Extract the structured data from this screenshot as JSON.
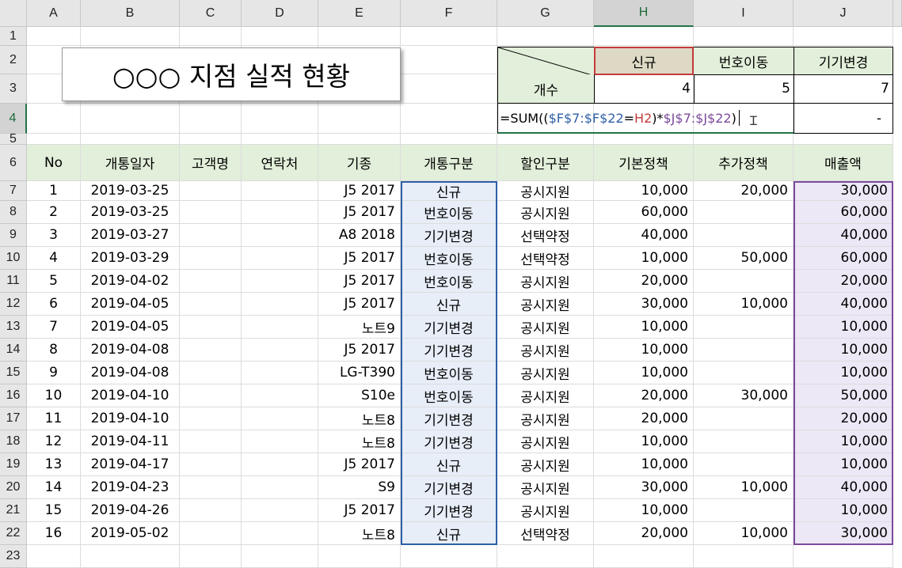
{
  "columns": [
    "A",
    "B",
    "C",
    "D",
    "E",
    "F",
    "G",
    "H",
    "I",
    "J"
  ],
  "rows": [
    "1",
    "2",
    "3",
    "4",
    "5",
    "6",
    "7",
    "8",
    "9",
    "10",
    "11",
    "12",
    "13",
    "14",
    "15",
    "16",
    "17",
    "18",
    "19",
    "20",
    "21",
    "22",
    "23"
  ],
  "selected_column": "H",
  "selected_row": "4",
  "title": "○○○ 지점  실적 현황",
  "summary": {
    "headers": [
      "신규",
      "번호이동",
      "기기변경"
    ],
    "row_label": "개수",
    "counts": [
      "4",
      "5",
      "7"
    ],
    "formula": {
      "p1": "=SUM((",
      "p2": "$F$7:$F$22",
      "p3": "=",
      "p4": "H2",
      "p5": ")*",
      "p6": "$J$7:$J$22",
      "p7": ")"
    },
    "dash": "-"
  },
  "table": {
    "headers": [
      "No",
      "개통일자",
      "고객명",
      "연락처",
      "기종",
      "개통구분",
      "할인구분",
      "기본정책",
      "추가정책",
      "매출액"
    ],
    "rows": [
      [
        "1",
        "2019-03-25",
        "",
        "",
        "J5 2017",
        "신규",
        "공시지원",
        "10,000",
        "20,000",
        "30,000"
      ],
      [
        "2",
        "2019-03-25",
        "",
        "",
        "J5 2017",
        "번호이동",
        "공시지원",
        "60,000",
        "",
        "60,000"
      ],
      [
        "3",
        "2019-03-27",
        "",
        "",
        "A8 2018",
        "기기변경",
        "선택약정",
        "40,000",
        "",
        "40,000"
      ],
      [
        "4",
        "2019-03-29",
        "",
        "",
        "J5 2017",
        "번호이동",
        "선택약정",
        "10,000",
        "50,000",
        "60,000"
      ],
      [
        "5",
        "2019-04-02",
        "",
        "",
        "J5 2017",
        "번호이동",
        "공시지원",
        "20,000",
        "",
        "20,000"
      ],
      [
        "6",
        "2019-04-05",
        "",
        "",
        "J5 2017",
        "신규",
        "공시지원",
        "30,000",
        "10,000",
        "40,000"
      ],
      [
        "7",
        "2019-04-05",
        "",
        "",
        "노트9",
        "기기변경",
        "공시지원",
        "10,000",
        "",
        "10,000"
      ],
      [
        "8",
        "2019-04-08",
        "",
        "",
        "J5 2017",
        "기기변경",
        "공시지원",
        "10,000",
        "",
        "10,000"
      ],
      [
        "9",
        "2019-04-08",
        "",
        "",
        "LG-T390",
        "번호이동",
        "공시지원",
        "10,000",
        "",
        "10,000"
      ],
      [
        "10",
        "2019-04-10",
        "",
        "",
        "S10e",
        "번호이동",
        "공시지원",
        "20,000",
        "30,000",
        "50,000"
      ],
      [
        "11",
        "2019-04-10",
        "",
        "",
        "노트8",
        "기기변경",
        "공시지원",
        "20,000",
        "",
        "20,000"
      ],
      [
        "12",
        "2019-04-11",
        "",
        "",
        "노트8",
        "기기변경",
        "공시지원",
        "10,000",
        "",
        "10,000"
      ],
      [
        "13",
        "2019-04-17",
        "",
        "",
        "J5 2017",
        "신규",
        "공시지원",
        "10,000",
        "",
        "10,000"
      ],
      [
        "14",
        "2019-04-23",
        "",
        "",
        "S9",
        "기기변경",
        "공시지원",
        "30,000",
        "10,000",
        "40,000"
      ],
      [
        "15",
        "2019-04-26",
        "",
        "",
        "J5 2017",
        "기기변경",
        "공시지원",
        "10,000",
        "",
        "10,000"
      ],
      [
        "16",
        "2019-05-02",
        "",
        "",
        "노트8",
        "신규",
        "선택약정",
        "20,000",
        "10,000",
        "30,000"
      ]
    ]
  },
  "colors": {
    "header_green": "#e2efda",
    "range_blue": "#e7eef8",
    "range_purple": "#ece8f6",
    "accent": "#217346"
  }
}
